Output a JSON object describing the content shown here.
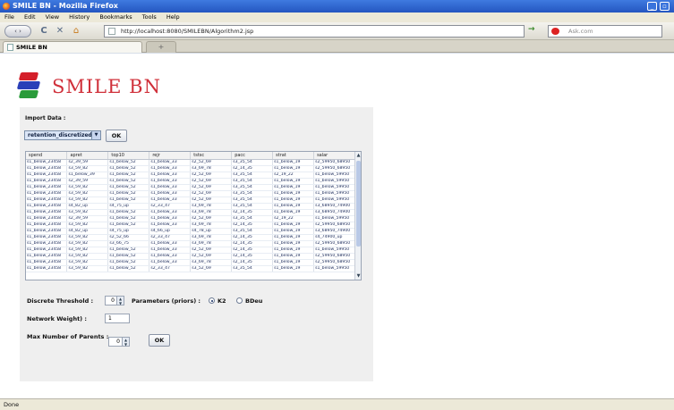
{
  "window": {
    "title": "SMILE BN - Mozilla Firefox",
    "min_glyph": "_",
    "max_glyph": "▫"
  },
  "menu": [
    "File",
    "Edit",
    "View",
    "History",
    "Bookmarks",
    "Tools",
    "Help"
  ],
  "nav": {
    "back_fwd": "‹ ›",
    "reload": "C",
    "stop": "✕",
    "home": "⌂",
    "url": "http://localhost:8080/SMILEBN/Algorithm2.jsp",
    "go": "→",
    "search_placeholder": "Ask.com"
  },
  "tabs": {
    "active_label": "SMILE BN",
    "new_tab": "+"
  },
  "page": {
    "app_title": "SMILE BN",
    "import_label": "Import Data :",
    "dataset_value": "retention_discretized",
    "ok_label": "OK",
    "table": {
      "columns": [
        "spend",
        "apret",
        "top10",
        "rejr",
        "tstsc",
        "pacc",
        "strat",
        "salar"
      ],
      "rows": [
        [
          "s1_below_23458",
          "s2_39_59",
          "s1_below_52",
          "s1_below_33",
          "s2_52_69",
          "s3_35_54",
          "s1_below_19",
          "s2_59950_68950"
        ],
        [
          "s1_below_23458",
          "s3_59_82",
          "s1_below_52",
          "s1_below_33",
          "s3_69_78",
          "s2_14_35",
          "s1_below_19",
          "s2_59950_68950"
        ],
        [
          "s1_below_23458",
          "s1_below_39",
          "s1_below_52",
          "s1_below_33",
          "s2_52_69",
          "s3_35_54",
          "s2_19_22",
          "s1_below_59950"
        ],
        [
          "s1_below_23458",
          "s2_39_59",
          "s1_below_52",
          "s1_below_33",
          "s2_52_69",
          "s3_35_54",
          "s1_below_19",
          "s1_below_59950"
        ],
        [
          "s1_below_23458",
          "s3_59_82",
          "s1_below_52",
          "s1_below_33",
          "s2_52_69",
          "s3_35_54",
          "s1_below_19",
          "s1_below_59950"
        ],
        [
          "s1_below_23458",
          "s3_59_82",
          "s1_below_52",
          "s1_below_33",
          "s2_52_69",
          "s3_35_54",
          "s1_below_19",
          "s1_below_59950"
        ],
        [
          "s1_below_23458",
          "s3_59_82",
          "s1_below_52",
          "s1_below_33",
          "s2_52_69",
          "s3_35_54",
          "s1_below_19",
          "s1_below_59950"
        ],
        [
          "s1_below_23458",
          "s4_82_up",
          "s4_75_up",
          "s2_33_47",
          "s3_69_78",
          "s3_35_54",
          "s1_below_19",
          "s3_68950_74900"
        ],
        [
          "s1_below_23458",
          "s3_59_82",
          "s1_below_52",
          "s1_below_33",
          "s3_69_78",
          "s2_14_35",
          "s1_below_19",
          "s3_68950_74900"
        ],
        [
          "s1_below_23458",
          "s2_39_59",
          "s1_below_52",
          "s1_below_33",
          "s2_52_69",
          "s3_35_54",
          "s2_19_22",
          "s1_below_59950"
        ],
        [
          "s1_below_23458",
          "s3_59_82",
          "s1_below_52",
          "s1_below_33",
          "s3_69_78",
          "s2_14_35",
          "s1_below_19",
          "s2_59950_68950"
        ],
        [
          "s1_below_23458",
          "s4_82_up",
          "s4_75_up",
          "s4_66_up",
          "s4_78_up",
          "s3_35_54",
          "s1_below_19",
          "s3_68950_74900"
        ],
        [
          "s1_below_23458",
          "s3_59_82",
          "s2_52_66",
          "s2_33_47",
          "s3_69_78",
          "s2_14_35",
          "s1_below_19",
          "s4_74900_up"
        ],
        [
          "s1_below_23458",
          "s3_59_82",
          "s3_66_75",
          "s1_below_33",
          "s3_69_78",
          "s2_14_35",
          "s1_below_19",
          "s2_59950_68950"
        ],
        [
          "s1_below_23458",
          "s3_59_82",
          "s1_below_52",
          "s1_below_33",
          "s2_52_69",
          "s2_14_35",
          "s1_below_19",
          "s1_below_59950"
        ],
        [
          "s1_below_23458",
          "s3_59_82",
          "s1_below_52",
          "s1_below_33",
          "s2_52_69",
          "s2_14_35",
          "s1_below_19",
          "s2_59950_68950"
        ],
        [
          "s1_below_23458",
          "s3_59_82",
          "s1_below_52",
          "s1_below_33",
          "s3_69_78",
          "s2_14_35",
          "s1_below_19",
          "s2_59950_68950"
        ],
        [
          "s1_below_23458",
          "s3_59_82",
          "s1_below_52",
          "s2_33_47",
          "s3_52_69",
          "s3_35_54",
          "s1_below_19",
          "s1_below_59950"
        ]
      ]
    },
    "discrete_threshold_label": "Discrete Threshold :",
    "discrete_threshold_value": "0",
    "parameters_label": "Parameters (priors) :",
    "radio_k2": "K2",
    "radio_bdeu": "BDeu",
    "network_weight_label": "Network Weight) :",
    "network_weight_value": "1",
    "max_parents_label": "Max Number of Parents :",
    "max_parents_value": "0",
    "ok2_label": "OK"
  },
  "status": "Done",
  "colors": {
    "title_bar": "#2f63d0",
    "app_title": "#d0303a",
    "panel": "#efefef"
  }
}
